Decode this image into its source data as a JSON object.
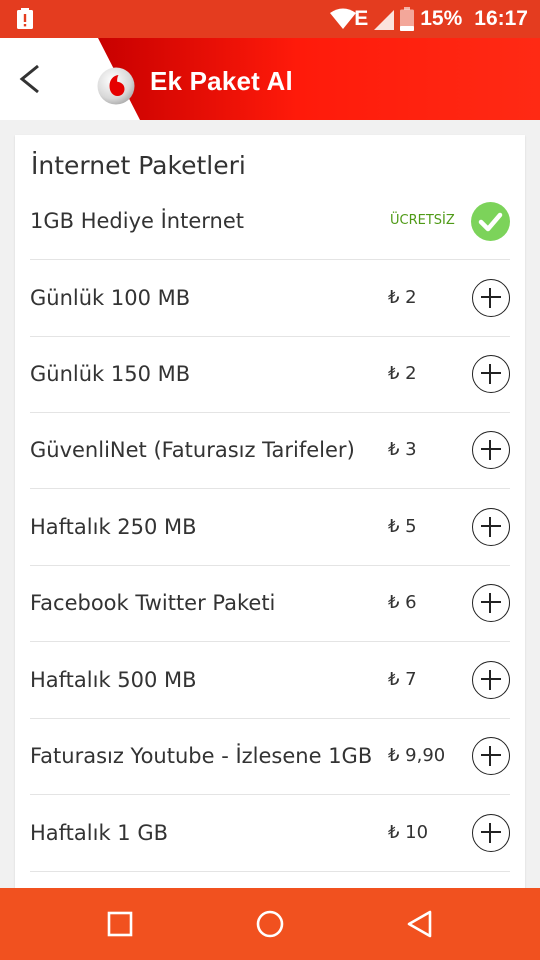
{
  "status_bar": {
    "battery_percent": "15%",
    "time": "16:17",
    "network_type": "E",
    "icons": [
      "alert-icon",
      "wifi-icon",
      "signal-icon",
      "battery-icon"
    ]
  },
  "app_bar": {
    "title": "Ek Paket Al",
    "back_icon": "chevron-left-icon",
    "logo": "vodafone-logo",
    "colors": {
      "brand_red": "#e60000",
      "status_orange": "#e43c1f"
    }
  },
  "section": {
    "title": "İnternet Paketleri"
  },
  "packages": [
    {
      "name": "1GB Hediye İnternet",
      "price": "ÜCRETSİZ",
      "selected": true
    },
    {
      "name": "Günlük 100 MB",
      "price": "₺ 2",
      "selected": false
    },
    {
      "name": "Günlük 150 MB",
      "price": "₺ 2",
      "selected": false
    },
    {
      "name": "GüvenliNet (Faturasız Tarifeler)",
      "price": "₺ 3",
      "selected": false
    },
    {
      "name": "Haftalık 250 MB",
      "price": "₺ 5",
      "selected": false
    },
    {
      "name": "Facebook Twitter Paketi",
      "price": "₺ 6",
      "selected": false
    },
    {
      "name": "Haftalık 500 MB",
      "price": "₺ 7",
      "selected": false
    },
    {
      "name": "Faturasız Youtube - İzlesene 1GB",
      "price": "₺ 9,90",
      "selected": false
    },
    {
      "name": "Haftalık 1 GB",
      "price": "₺ 10",
      "selected": false
    }
  ],
  "nav_bar": {
    "buttons": [
      "recents-icon",
      "home-icon",
      "back-triangle-icon"
    ],
    "color": "#f1511f"
  }
}
